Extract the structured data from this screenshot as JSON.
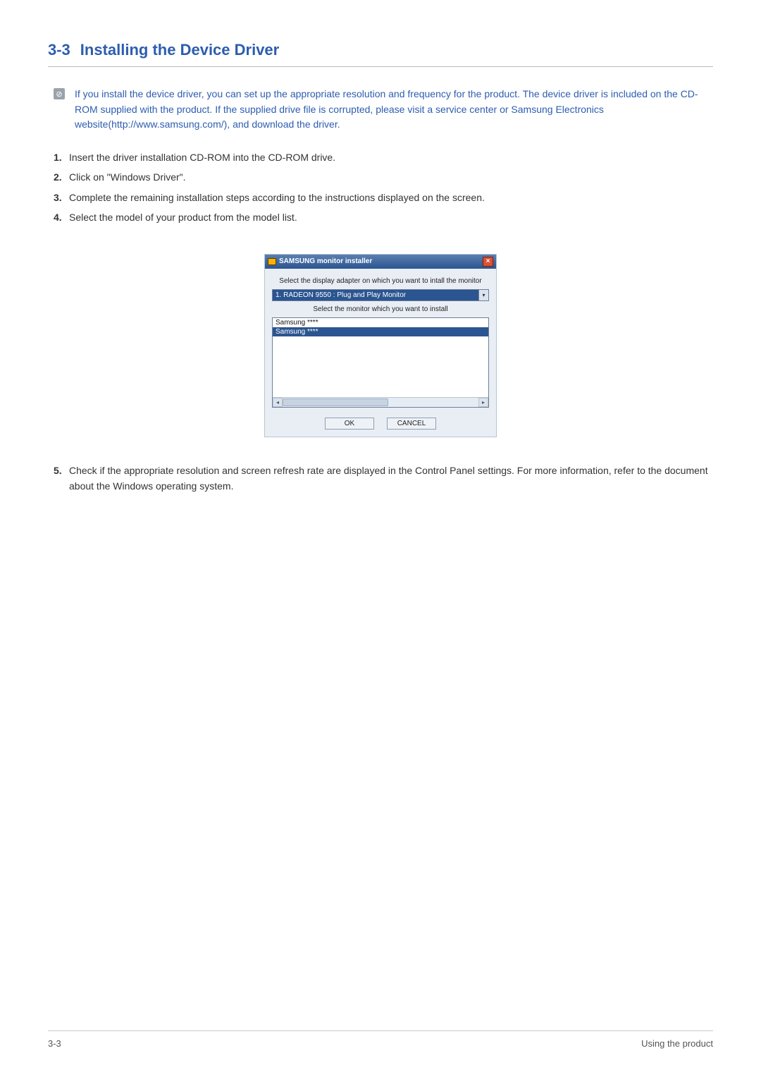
{
  "heading": {
    "number": "3-3",
    "title": "Installing the Device Driver"
  },
  "note": {
    "icon_glyph": "⊘",
    "text": "If you install the device driver, you can set up the appropriate resolution and frequency for the product. The device driver is included on the CD-ROM supplied with the product. If the supplied drive file is corrupted, please visit a service center or Samsung Electronics website(http://www.samsung.com/), and download the driver."
  },
  "steps": [
    "Insert the driver installation CD-ROM into the CD-ROM drive.",
    "Click on \"Windows Driver\".",
    "Complete the remaining installation steps according to the instructions displayed on the screen.",
    "Select the model of your product from the model list."
  ],
  "dialog": {
    "title": "SAMSUNG monitor installer",
    "close_glyph": "×",
    "label_adapter": "Select the display adapter on which you want to intall the monitor",
    "adapter_value": "1. RADEON 9550 : Plug and Play Monitor",
    "dropdown_glyph": "▾",
    "label_monitor": "Select the monitor which you want to install",
    "list_items": [
      "Samsung ****",
      "Samsung ****"
    ],
    "list_selected_index": 1,
    "scroll_left_glyph": "◂",
    "scroll_right_glyph": "▸",
    "ok_label": "OK",
    "cancel_label": "CANCEL"
  },
  "step5": "Check if the appropriate resolution and screen refresh rate are displayed in the Control Panel settings. For more information, refer to the document about the Windows operating system.",
  "footer": {
    "left": "3-3",
    "right": "Using the product"
  }
}
